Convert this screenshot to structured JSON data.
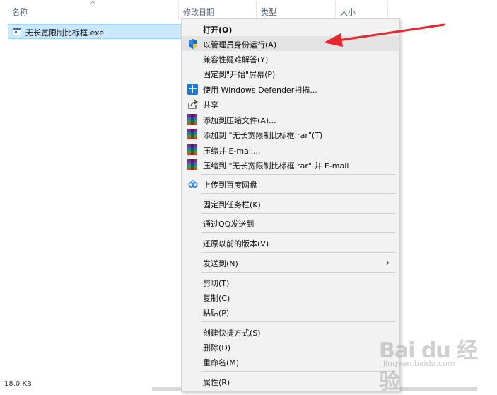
{
  "columns": {
    "name": "名称",
    "modified": "修改日期",
    "type": "类型",
    "size": "大小"
  },
  "file": {
    "name": "无长宽限制比标框.exe",
    "icon": "exe-file-icon"
  },
  "status_bar": {
    "size_text": "18.0 KB"
  },
  "context_menu": {
    "open": "打开(O)",
    "run_as_admin": "以管理员身份运行(A)",
    "compat_troubleshoot": "兼容性疑难解答(Y)",
    "pin_start": "固定到\"开始\"屏幕(P)",
    "defender_scan": "使用 Windows Defender扫描...",
    "share": "共享",
    "add_archive": "添加到压缩文件(A)...",
    "add_to_rar": "添加到 \"无长宽限制比标框.rar\"(T)",
    "compress_email": "压缩并 E-mail...",
    "compress_rar_email": "压缩到 \"无长宽限制比标框.rar\" 并 E-mail",
    "baidu_upload": "上传到百度网盘",
    "pin_taskbar": "固定到任务栏(K)",
    "send_qq": "通过QQ发送到",
    "restore_previous": "还原以前的版本(V)",
    "send_to": "发送到(N)",
    "cut": "剪切(T)",
    "copy": "复制(C)",
    "paste": "粘贴(P)",
    "create_shortcut": "创建快捷方式(S)",
    "delete": "删除(D)",
    "rename": "重命名(M)",
    "properties": "属性(R)"
  },
  "watermark": {
    "logo": "Bai du 经验",
    "url": "jingyan.baidu.com"
  },
  "colors": {
    "selection_bg": "#cce8ff",
    "menu_bg": "#f2f2f2",
    "annotation_arrow": "#e8262b",
    "header_text": "#4c607a"
  }
}
